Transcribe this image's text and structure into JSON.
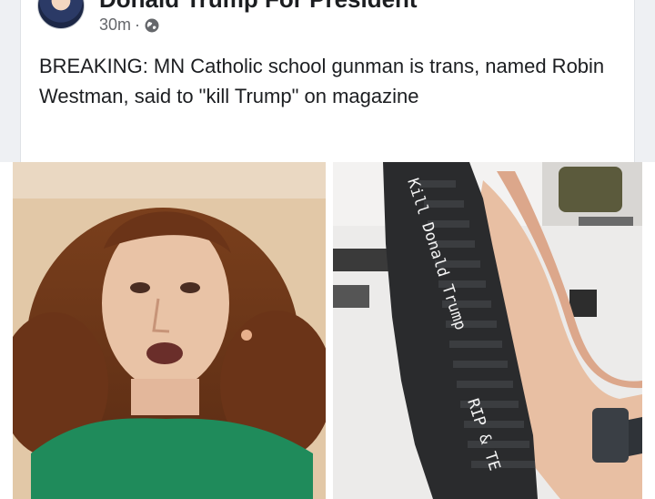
{
  "post": {
    "page_name": "Donald Trump For President",
    "timestamp": "30m",
    "separator": "·",
    "audience_icon": "globe-icon",
    "body_text": "BREAKING: MN Catholic school gunman is trans, named Robin Westman, said to \"kill Trump\" on magazine"
  },
  "photos": {
    "right_handwriting": {
      "line1": "Kill Donald Trump",
      "line2": "RIP & TE"
    }
  }
}
